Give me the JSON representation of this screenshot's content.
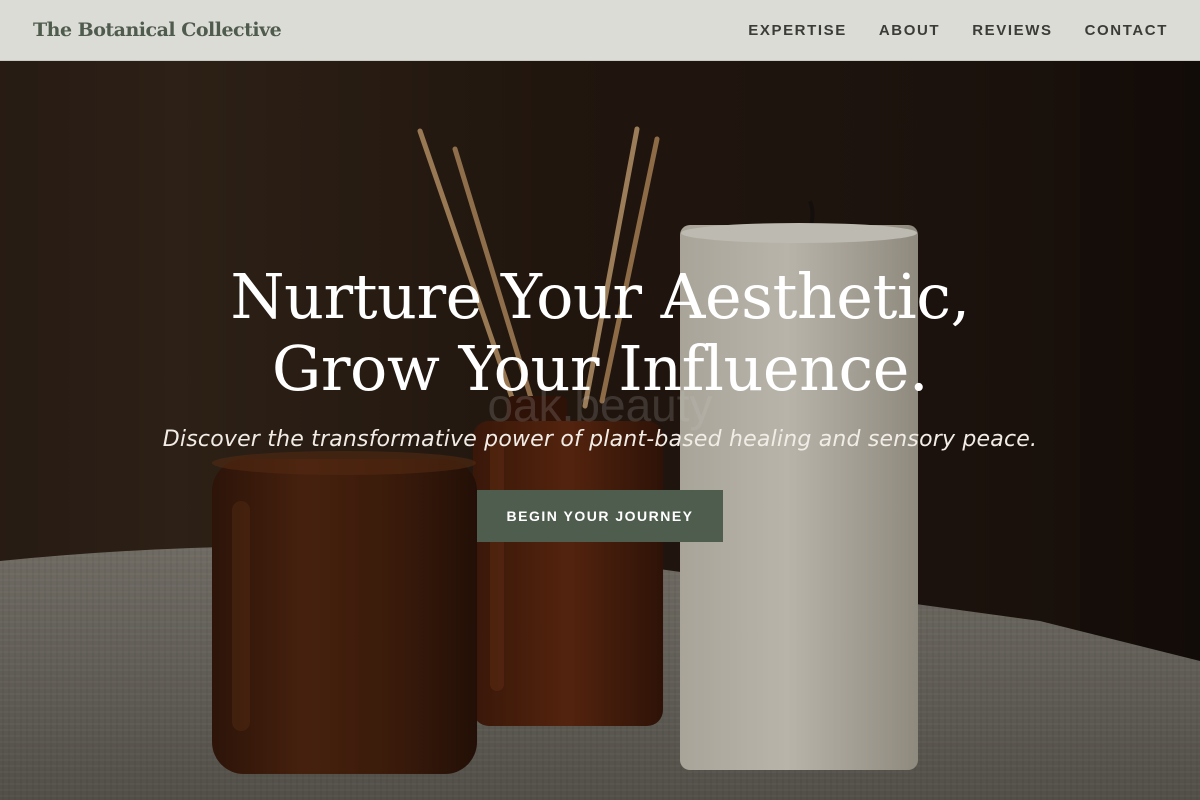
{
  "header": {
    "brand": "The Botanical Collective",
    "nav": [
      {
        "label": "EXPERTISE"
      },
      {
        "label": "ABOUT"
      },
      {
        "label": "REVIEWS"
      },
      {
        "label": "CONTACT"
      }
    ]
  },
  "hero": {
    "title_line1": "Nurture Your Aesthetic,",
    "title_line2": "Grow Your Influence.",
    "subtitle": "Discover the transformative power of plant-based healing and sensory peace.",
    "cta_label": "BEGIN YOUR JOURNEY",
    "watermark": "oak.beauty"
  },
  "colors": {
    "header_bg": "#dcdcd7",
    "brand": "#4f5b4d",
    "cta_bg": "#4f5d4f",
    "hero_text": "#ffffff"
  }
}
